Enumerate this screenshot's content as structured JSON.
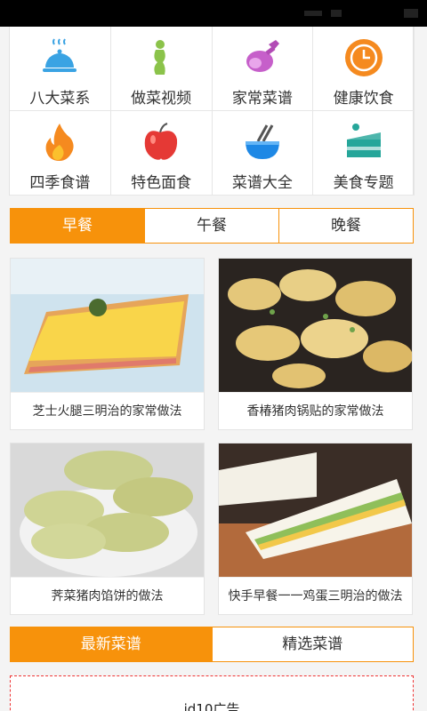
{
  "categories": [
    {
      "label": "八大菜系",
      "icon": "cloche-icon"
    },
    {
      "label": "做菜视频",
      "icon": "figure-icon"
    },
    {
      "label": "家常菜谱",
      "icon": "ham-icon"
    },
    {
      "label": "健康饮食",
      "icon": "clock-icon"
    },
    {
      "label": "四季食谱",
      "icon": "flame-icon"
    },
    {
      "label": "特色面食",
      "icon": "apple-icon"
    },
    {
      "label": "菜谱大全",
      "icon": "pot-icon"
    },
    {
      "label": "美食专题",
      "icon": "cake-slice-icon"
    }
  ],
  "meal_tabs": [
    {
      "label": "早餐",
      "active": true
    },
    {
      "label": "午餐",
      "active": false
    },
    {
      "label": "晚餐",
      "active": false
    }
  ],
  "recipes": [
    {
      "title": "芝士火腿三明治的家常做法"
    },
    {
      "title": "香椿猪肉锅贴的家常做法"
    },
    {
      "title": "荠菜猪肉馅饼的做法"
    },
    {
      "title": "快手早餐一一鸡蛋三明治的做法"
    }
  ],
  "list_tabs": [
    {
      "label": "最新菜谱",
      "active": true
    },
    {
      "label": "精选菜谱",
      "active": false
    }
  ],
  "ad": {
    "text": "id10广告"
  },
  "colors": {
    "accent": "#f7920b",
    "ad_border": "#ee3333"
  }
}
